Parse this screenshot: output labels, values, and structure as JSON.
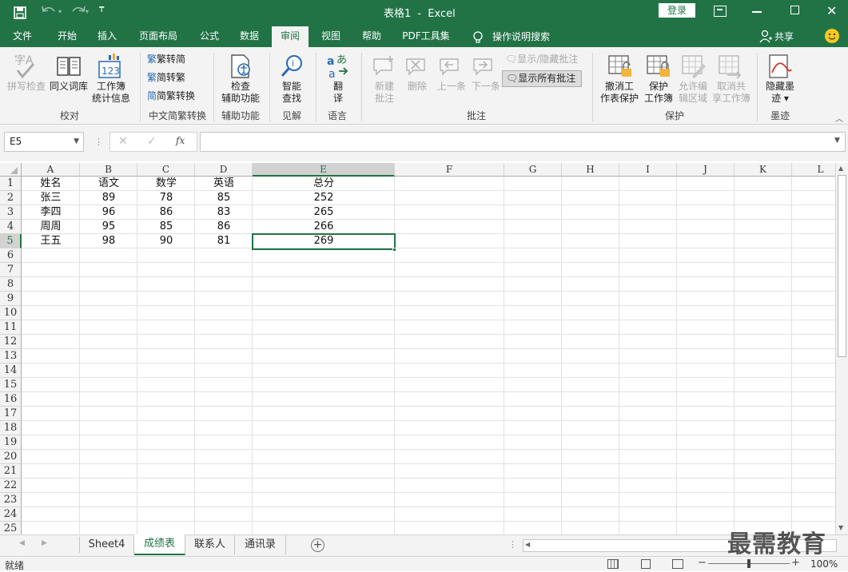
{
  "title": {
    "doc": "表格1",
    "sep": "-",
    "app": "Excel",
    "login": "登录"
  },
  "tabs": [
    "文件",
    "开始",
    "插入",
    "页面布局",
    "公式",
    "数据",
    "审阅",
    "视图",
    "帮助",
    "PDF工具集"
  ],
  "tell_me": "操作说明搜索",
  "share": "共享",
  "ribbon": {
    "spell": "拼写检查",
    "thesaurus": "同义词库",
    "stats1": "工作簿",
    "stats2": "统计信息",
    "g_proofing": "校对",
    "trad": "繁转简",
    "simp": "简转繁",
    "convert": "简繁转换",
    "g_chinese": "中文简繁转换",
    "check1": "检查",
    "check2": "辅助功能",
    "g_access": "辅助功能",
    "smart1": "智能",
    "smart2": "查找",
    "g_insights": "见解",
    "translate1": "翻",
    "translate2": "译",
    "g_language": "语言",
    "new1": "新建",
    "new2": "批注",
    "delete": "删除",
    "prev": "上一条",
    "next": "下一条",
    "show_hide": "显示/隐藏批注",
    "show_all": "显示所有批注",
    "g_comments": "批注",
    "unprotect1": "撤消工",
    "unprotect2": "作表保护",
    "protect1": "保护",
    "protect2": "工作簿",
    "allow1": "允许编",
    "allow2": "辑区域",
    "unshare1": "取消共",
    "unshare2": "享工作簿",
    "g_protect": "保护",
    "ink1": "隐藏墨",
    "ink2": "迹",
    "g_ink": "墨迹"
  },
  "formula_bar": {
    "name_box": "E5",
    "fx": "fx",
    "value": ""
  },
  "columns": [
    "A",
    "B",
    "C",
    "D",
    "E",
    "F",
    "G",
    "H",
    "I",
    "J",
    "K",
    "L"
  ],
  "rows": [
    "1",
    "2",
    "3",
    "4",
    "5",
    "6",
    "7",
    "8",
    "9",
    "10",
    "11",
    "12",
    "13",
    "14",
    "15",
    "16",
    "17",
    "18",
    "19",
    "20",
    "21",
    "22",
    "23",
    "24",
    "25"
  ],
  "table": [
    [
      "姓名",
      "语文",
      "数学",
      "英语",
      "总分"
    ],
    [
      "张三",
      "89",
      "78",
      "85",
      "252"
    ],
    [
      "李四",
      "96",
      "86",
      "83",
      "265"
    ],
    [
      "周周",
      "95",
      "85",
      "86",
      "266"
    ],
    [
      "王五",
      "98",
      "90",
      "81",
      "269"
    ]
  ],
  "sheets": [
    "Sheet4",
    "成绩表",
    "联系人",
    "通讯录"
  ],
  "active_sheet": "成绩表",
  "status": {
    "ready": "就绪",
    "zoom": "100%"
  },
  "watermark": "最需教育",
  "colors": {
    "brand": "#217346",
    "ribbon_bg": "#f3f3f3",
    "selection": "#217346"
  }
}
